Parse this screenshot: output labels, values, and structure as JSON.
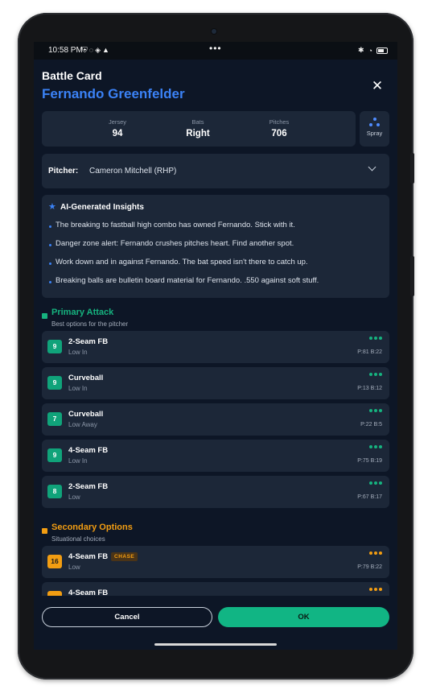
{
  "status_bar": {
    "time": "10:58 PM",
    "icons_left": [
      "shield-icon",
      "sync-icon",
      "vpn-icon",
      "warning-icon"
    ],
    "center_dots": "•••",
    "icons_right": [
      "bluetooth-icon",
      "wifi-icon",
      "battery-icon"
    ]
  },
  "header": {
    "label": "Battle Card",
    "player_name": "Fernando Greenfelder",
    "close_icon": "close-icon"
  },
  "stats": [
    {
      "label": "Jersey",
      "value": "94"
    },
    {
      "label": "Bats",
      "value": "Right"
    },
    {
      "label": "Pitches",
      "value": "706"
    }
  ],
  "spray": {
    "label": "Spray",
    "icon": "spray-chart-icon"
  },
  "pitcher": {
    "label": "Pitcher:",
    "value": "Cameron Mitchell (RHP)",
    "icon": "chevron-down-icon"
  },
  "insights": {
    "title": "AI-Generated Insights",
    "icon": "star-icon",
    "items": [
      "The breaking to fastball high combo has owned Fernando. Stick with it.",
      "Danger zone alert: Fernando crushes pitches heart. Find another spot.",
      "Work down and in against Fernando. The bat speed isn't there to catch up.",
      "Breaking balls are bulletin board material for Fernando. .550 against soft stuff."
    ]
  },
  "primary": {
    "title": "Primary Attack",
    "subtitle": "Best options for the pitcher",
    "color": "#16b37f",
    "pitches": [
      {
        "rank": "9",
        "name": "2-Seam FB",
        "location": "Low In",
        "pb": "P:81 B:22"
      },
      {
        "rank": "9",
        "name": "Curveball",
        "location": "Low In",
        "pb": "P:13 B:12"
      },
      {
        "rank": "7",
        "name": "Curveball",
        "location": "Low Away",
        "pb": "P:22 B:5"
      },
      {
        "rank": "9",
        "name": "4-Seam FB",
        "location": "Low In",
        "pb": "P:75 B:19"
      },
      {
        "rank": "8",
        "name": "2-Seam FB",
        "location": "Low",
        "pb": "P:67 B:17"
      }
    ]
  },
  "secondary": {
    "title": "Secondary Options",
    "subtitle": "Situational choices",
    "color": "#f29d12",
    "pitches": [
      {
        "rank": "16",
        "name": "4-Seam FB",
        "tag": "CHASE",
        "location": "Low",
        "pb": "P:79 B:22"
      },
      {
        "rank": "",
        "name": "4-Seam FB",
        "location": "",
        "pb": ""
      }
    ]
  },
  "footer": {
    "cancel_label": "Cancel",
    "ok_label": "OK"
  }
}
